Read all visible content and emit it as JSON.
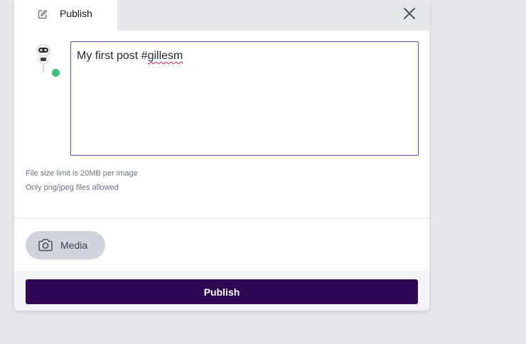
{
  "header": {
    "tab_label": "Publish",
    "tab_icon": "edit-icon",
    "close_icon": "close-icon"
  },
  "composer": {
    "text_before": "My first post #",
    "text_misspelled": "gillesm",
    "avatar_icon": "robot-avatar-icon",
    "status": "online",
    "status_color": "#34c47a"
  },
  "hints": {
    "size_limit": "File size limit is 20MB per image",
    "formats": "Only png/jpeg files allowed"
  },
  "media": {
    "label": "Media",
    "icon": "camera-icon"
  },
  "footer": {
    "publish_label": "Publish",
    "publish_color": "#2e0854"
  }
}
